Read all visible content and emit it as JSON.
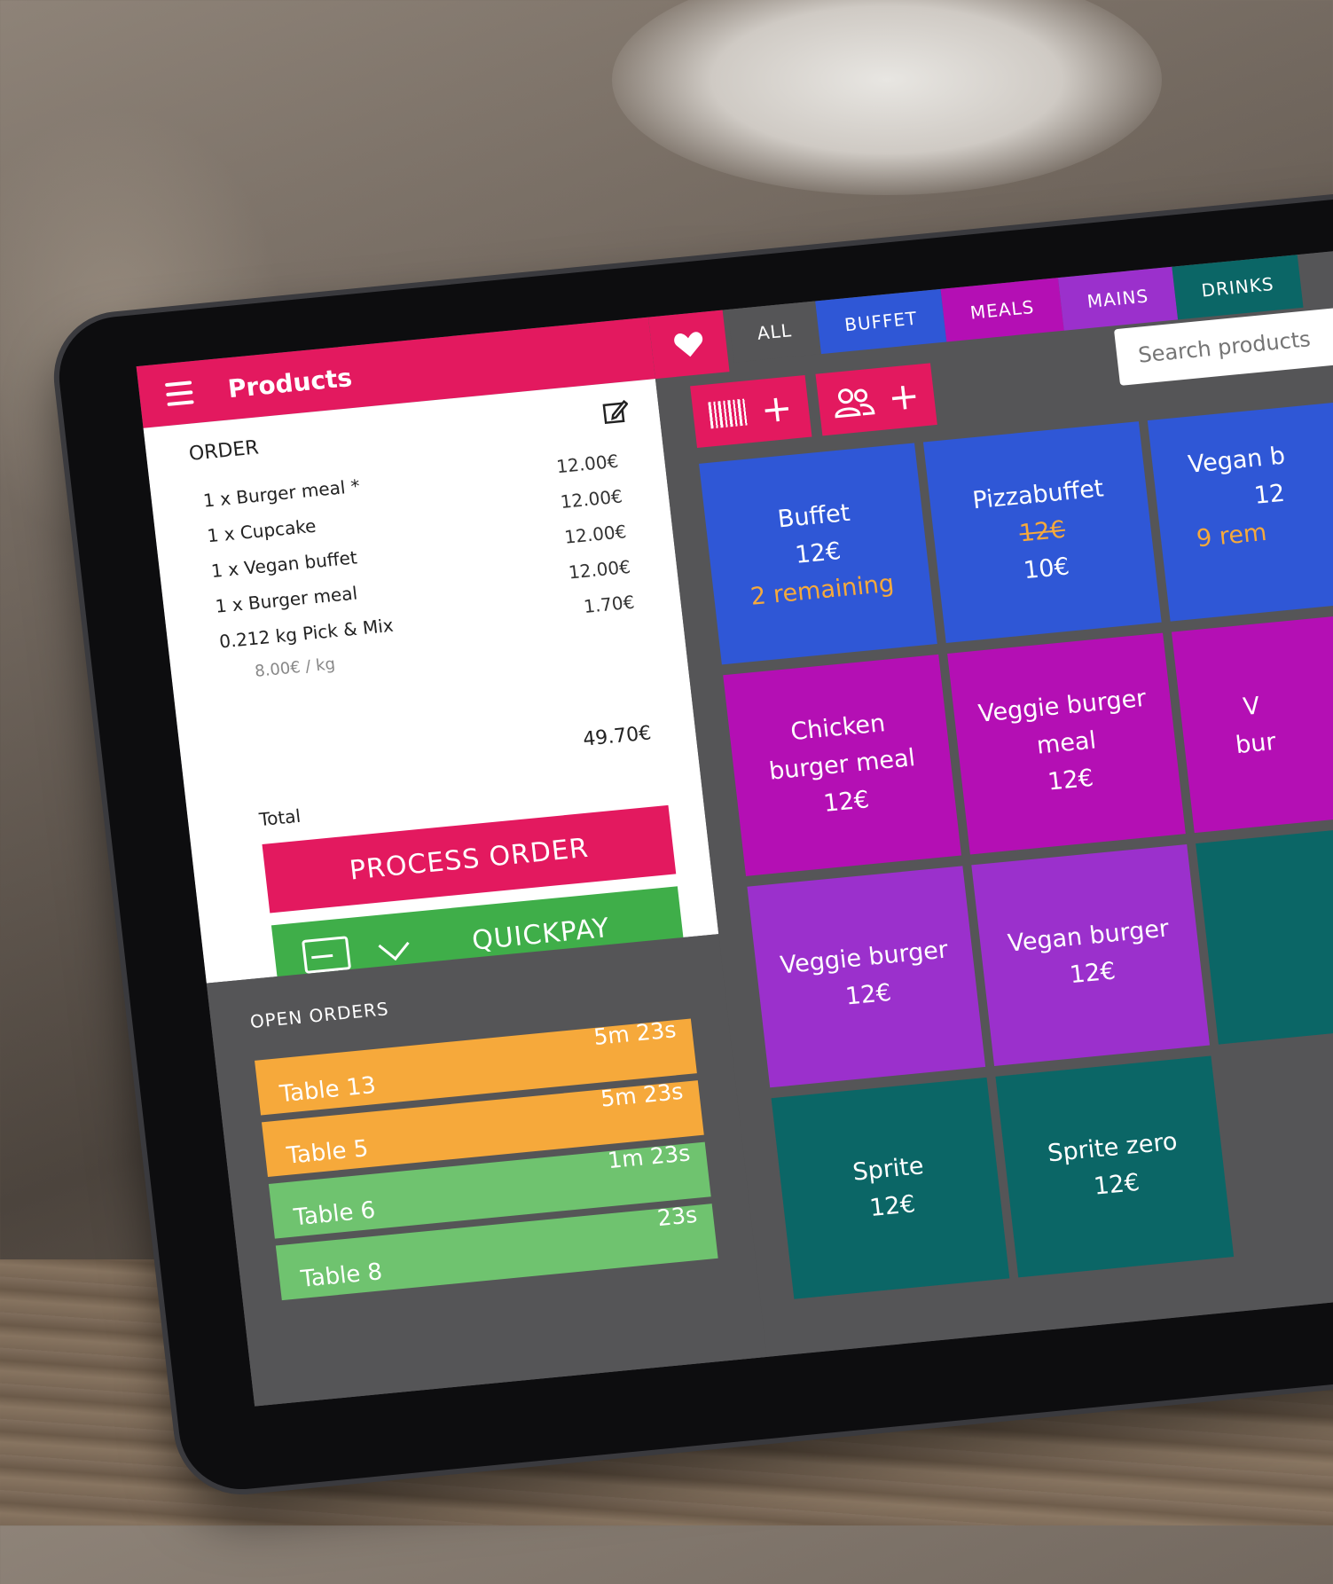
{
  "header": {
    "title": "Products"
  },
  "order": {
    "label": "ORDER",
    "lines": [
      {
        "name": "1 x Burger meal *",
        "price": "12.00€"
      },
      {
        "name": "1 x Cupcake",
        "price": "12.00€"
      },
      {
        "name": "1 x Vegan buffet",
        "price": "12.00€"
      },
      {
        "name": "1 x Burger meal",
        "price": "12.00€"
      },
      {
        "name": "0.212 kg Pick & Mix",
        "price": "1.70€"
      }
    ],
    "unit_price": "8.00€ / kg",
    "total_amount": "49.70€",
    "total_label": "Total",
    "process_label": "PROCESS ORDER",
    "quickpay_label": "QUICKPAY"
  },
  "open_orders": {
    "title": "OPEN ORDERS",
    "rows": [
      {
        "table": "Table 13",
        "time": "5m 23s",
        "color": "#f6a93b"
      },
      {
        "table": "Table 5",
        "time": "5m 23s",
        "color": "#f6a93b"
      },
      {
        "table": "Table 6",
        "time": "1m 23s",
        "color": "#6fc36f"
      },
      {
        "table": "Table 8",
        "time": "23s",
        "color": "#6fc36f"
      }
    ]
  },
  "tabs": [
    {
      "label": "ALL",
      "color": "#555557"
    },
    {
      "label": "BUFFET",
      "color": "#2f57d6"
    },
    {
      "label": "MEALS",
      "color": "#b40fb4"
    },
    {
      "label": "MAINS",
      "color": "#9b30cc"
    },
    {
      "label": "DRINKS",
      "color": "#0b6666"
    }
  ],
  "search": {
    "placeholder": "Search products"
  },
  "products": [
    {
      "name": "Buffet",
      "price": "12€",
      "note": "2 remaining",
      "color": "#2f57d6"
    },
    {
      "name": "Pizzabuffet",
      "old_price": "12€",
      "price": "10€",
      "color": "#2f57d6"
    },
    {
      "name": "Vegan b",
      "price": "12",
      "note": "9 rem",
      "color": "#2f57d6"
    },
    {
      "name": "Chicken burger meal",
      "price": "12€",
      "color": "#b40fb4"
    },
    {
      "name": "Veggie burger meal",
      "price": "12€",
      "color": "#b40fb4"
    },
    {
      "name": "V bur",
      "price": "",
      "color": "#b40fb4"
    },
    {
      "name": "Veggie burger",
      "price": "12€",
      "color": "#9b30cc"
    },
    {
      "name": "Vegan burger",
      "price": "12€",
      "color": "#9b30cc"
    },
    {
      "name": "Sprite",
      "price": "12€",
      "color": "#0b6666"
    },
    {
      "name": "Sprite zero",
      "price": "12€",
      "color": "#0b6666"
    }
  ],
  "colors": {
    "accent": "#e3195f",
    "quickpay": "#3fae49",
    "panel": "#555557"
  }
}
